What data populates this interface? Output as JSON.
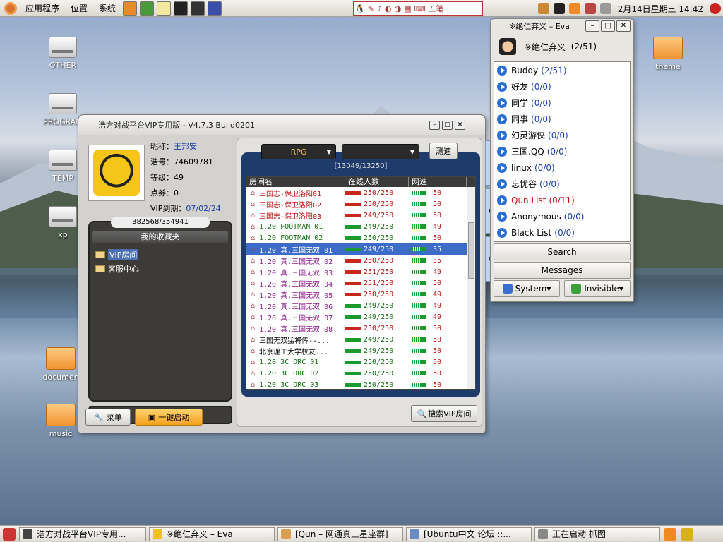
{
  "top_panel": {
    "menus": [
      "应用程序",
      "位置",
      "系统"
    ],
    "ime_items": [
      "五笔"
    ],
    "clock": "2月14日星期三 14:42",
    "colors": {
      "panel": "#dcd8d0",
      "ubuntu": "#d8732b"
    }
  },
  "desktop_icons": [
    {
      "label": "OTHER",
      "type": "drive"
    },
    {
      "label": "PROGRAM",
      "type": "drive"
    },
    {
      "label": "TEMP",
      "type": "drive"
    },
    {
      "label": "xp",
      "type": "drive"
    },
    {
      "label": "documen",
      "type": "folder"
    },
    {
      "label": "music",
      "type": "folder"
    },
    {
      "label": "theme",
      "type": "folder"
    }
  ],
  "main_window": {
    "title": "浩方对战平台VIP专用版 - V4.7.3 Build0201",
    "profile": {
      "nickname_label": "昵称：",
      "nickname": "王邦安",
      "id_label": "浩号：",
      "id": "74609781",
      "level_label": "等级：",
      "level": "49",
      "points_label": "点券：",
      "points": "0",
      "vip_label": "VIP到期：",
      "vip": "07/02/24"
    },
    "favorites": {
      "count": "382568/354941",
      "header": "我的收藏夹",
      "items": [
        "VIP房间",
        "客服中心"
      ]
    },
    "menu_button": "菜单",
    "launch_button": "一键启动",
    "category_select": "RPG",
    "sub_select": "",
    "speedtest_button": "测速",
    "room_count": "[13049/13250]",
    "columns": [
      "房间名",
      "在线人数",
      "网速"
    ],
    "rooms": [
      {
        "name": "三国志-保卫洛阳01",
        "count": "250/250",
        "speed": "50",
        "color": "#c01010",
        "full": true
      },
      {
        "name": "三国志-保卫洛阳02",
        "count": "250/250",
        "speed": "50",
        "color": "#c01010",
        "full": true
      },
      {
        "name": "三国志-保卫洛阳03",
        "count": "249/250",
        "speed": "50",
        "color": "#c01010",
        "full": true
      },
      {
        "name": "1.20 FOOTMAN 01",
        "count": "249/250",
        "speed": "49",
        "color": "#107010",
        "full": false
      },
      {
        "name": "1.20 FOOTMAN 02",
        "count": "250/250",
        "speed": "50",
        "color": "#107010",
        "full": false
      },
      {
        "name": "1.20 真.三国无双 01",
        "count": "249/250",
        "speed": "35",
        "color": "#ffffff",
        "full": false,
        "selected": true
      },
      {
        "name": "1.20 真.三国无双 02",
        "count": "250/250",
        "speed": "35",
        "color": "#8a1a8a",
        "full": true
      },
      {
        "name": "1.20 真.三国无双 03",
        "count": "251/250",
        "speed": "49",
        "color": "#8a1a8a",
        "full": true
      },
      {
        "name": "1.20 真.三国无双 04",
        "count": "251/250",
        "speed": "50",
        "color": "#8a1a8a",
        "full": true
      },
      {
        "name": "1.20 真.三国无双 05",
        "count": "250/250",
        "speed": "49",
        "color": "#8a1a8a",
        "full": true
      },
      {
        "name": "1.20 真.三国无双 06",
        "count": "249/250",
        "speed": "49",
        "color": "#8a1a8a",
        "full": false
      },
      {
        "name": "1.20 真.三国无双 07",
        "count": "249/250",
        "speed": "49",
        "color": "#8a1a8a",
        "full": false
      },
      {
        "name": "1.20 真.三国无双 08",
        "count": "250/250",
        "speed": "50",
        "color": "#8a1a8a",
        "full": true
      },
      {
        "name": "三国无双猛将传--...",
        "count": "249/250",
        "speed": "50",
        "color": "#000000",
        "full": false
      },
      {
        "name": "北京理工大学校友...",
        "count": "249/250",
        "speed": "50",
        "color": "#000000",
        "full": false
      },
      {
        "name": "1.20 3C ORC 01",
        "count": "250/250",
        "speed": "50",
        "color": "#107010",
        "full": false
      },
      {
        "name": "1.20 3C ORC 02",
        "count": "250/250",
        "speed": "50",
        "color": "#107010",
        "full": false
      },
      {
        "name": "1.20 3C ORC 03",
        "count": "250/250",
        "speed": "50",
        "color": "#107010",
        "full": false
      }
    ],
    "search_vip_button": "搜索VIP房间"
  },
  "eva_window": {
    "title": "※绝仁弃义 – Eva",
    "user_name": "※绝仁弃义",
    "user_count": "(2/51)",
    "groups": [
      {
        "name": "Buddy",
        "count": "(2/51)",
        "red": false
      },
      {
        "name": "好友",
        "count": "(0/0)",
        "red": false
      },
      {
        "name": "同学",
        "count": "(0/0)",
        "red": false
      },
      {
        "name": "同事",
        "count": "(0/0)",
        "red": false
      },
      {
        "name": "幻灵游侠",
        "count": "(0/0)",
        "red": false
      },
      {
        "name": "三国.QQ",
        "count": "(0/0)",
        "red": false
      },
      {
        "name": "linux",
        "count": "(0/0)",
        "red": false
      },
      {
        "name": "忘忧谷",
        "count": "(0/0)",
        "red": false
      },
      {
        "name": "Qun List",
        "count": "(0/11)",
        "red": true
      },
      {
        "name": "Anonymous",
        "count": "(0/0)",
        "red": false
      },
      {
        "name": "Black List",
        "count": "(0/0)",
        "red": false
      }
    ],
    "search_button": "Search",
    "messages_button": "Messages",
    "system_button": "System",
    "invisible_button": "Invisible"
  },
  "taskbar": [
    {
      "label": "浩方对战平台VIP专用..."
    },
    {
      "label": "※绝仁弃义 – Eva"
    },
    {
      "label": "[Qun – 网通真三星座群]"
    },
    {
      "label": "[Ubuntu中文 论坛 ::..."
    },
    {
      "label": "正在启动 抓图"
    }
  ]
}
